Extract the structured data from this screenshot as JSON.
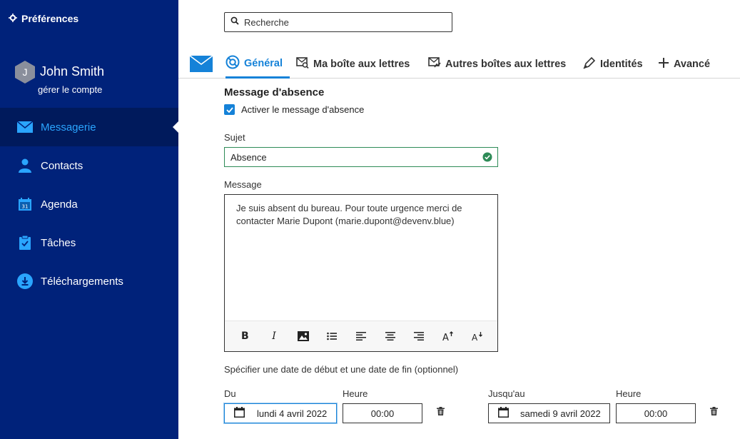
{
  "sidebar": {
    "prefs_label": "Préférences",
    "user": {
      "initial": "J",
      "name": "John Smith",
      "manage_label": "gérer le compte"
    },
    "items": [
      {
        "label": "Messagerie",
        "icon": "mail-icon",
        "active": true
      },
      {
        "label": "Contacts",
        "icon": "person-icon"
      },
      {
        "label": "Agenda",
        "icon": "calendar-icon"
      },
      {
        "label": "Tâches",
        "icon": "clipboard-icon"
      },
      {
        "label": "Téléchargements",
        "icon": "download-icon"
      }
    ]
  },
  "search": {
    "placeholder": "Recherche"
  },
  "tabs": [
    {
      "label": "Général",
      "icon": "lifebuoy-icon",
      "active": true
    },
    {
      "label": "Ma boîte aux lettres",
      "icon": "mailbox-search-icon"
    },
    {
      "label": "Autres boîtes aux lettres",
      "icon": "mailbox-shared-icon"
    },
    {
      "label": "Identités",
      "icon": "pen-icon"
    },
    {
      "label": "Avancé",
      "icon": "plus-icon"
    }
  ],
  "absence": {
    "title": "Message d'absence",
    "enable_label": "Activer le message d'absence",
    "enabled": true,
    "subject_label": "Sujet",
    "subject_value": "Absence",
    "message_label": "Message",
    "message_value": "Je suis absent du bureau. Pour toute urgence merci de contacter Marie Dupont (marie.dupont@devenv.blue)",
    "date_hint": "Spécifier une date de début et une date de fin (optionnel)",
    "from_label": "Du",
    "from_date": "lundi 4 avril 2022",
    "from_time_label": "Heure",
    "from_time": "00:00",
    "to_label": "Jusqu'au",
    "to_date": "samedi 9 avril 2022",
    "to_time_label": "Heure",
    "to_time": "00:00"
  },
  "colors": {
    "sidebar": "#00227a",
    "accent": "#1582d8",
    "valid": "#2e8b57"
  }
}
